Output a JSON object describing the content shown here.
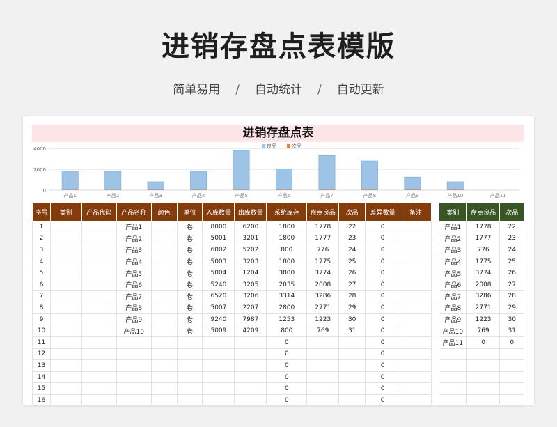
{
  "page": {
    "title": "进销存盘点表模版",
    "tags": [
      "简单易用",
      "自动统计",
      "自动更新"
    ],
    "separator": "/"
  },
  "sheet": {
    "title": "进销存盘点表",
    "columns": [
      "序号",
      "类别",
      "产品代码",
      "产品名称",
      "颜色",
      "单位",
      "入库数量",
      "出库数量",
      "系统库存",
      "盘点良品",
      "次品",
      "差异数量",
      "备注"
    ],
    "rows": [
      [
        "1",
        "",
        "",
        "产品1",
        "",
        "卷",
        "8000",
        "6200",
        "1800",
        "1778",
        "22",
        "0",
        ""
      ],
      [
        "2",
        "",
        "",
        "产品2",
        "",
        "卷",
        "5001",
        "3201",
        "1800",
        "1777",
        "23",
        "0",
        ""
      ],
      [
        "3",
        "",
        "",
        "产品3",
        "",
        "卷",
        "6002",
        "5202",
        "800",
        "776",
        "24",
        "0",
        ""
      ],
      [
        "4",
        "",
        "",
        "产品4",
        "",
        "卷",
        "5003",
        "3203",
        "1800",
        "1775",
        "25",
        "0",
        ""
      ],
      [
        "5",
        "",
        "",
        "产品5",
        "",
        "卷",
        "5004",
        "1204",
        "3800",
        "3774",
        "26",
        "0",
        ""
      ],
      [
        "6",
        "",
        "",
        "产品6",
        "",
        "卷",
        "5240",
        "3205",
        "2035",
        "2008",
        "27",
        "0",
        ""
      ],
      [
        "7",
        "",
        "",
        "产品7",
        "",
        "卷",
        "6520",
        "3206",
        "3314",
        "3286",
        "28",
        "0",
        ""
      ],
      [
        "8",
        "",
        "",
        "产品8",
        "",
        "卷",
        "5007",
        "2207",
        "2800",
        "2771",
        "29",
        "0",
        ""
      ],
      [
        "9",
        "",
        "",
        "产品9",
        "",
        "卷",
        "9240",
        "7987",
        "1253",
        "1223",
        "30",
        "0",
        ""
      ],
      [
        "10",
        "",
        "",
        "产品10",
        "",
        "卷",
        "5009",
        "4209",
        "800",
        "769",
        "31",
        "0",
        ""
      ],
      [
        "11",
        "",
        "",
        "",
        "",
        "",
        "",
        "",
        "0",
        "",
        "",
        "0",
        ""
      ],
      [
        "12",
        "",
        "",
        "",
        "",
        "",
        "",
        "",
        "0",
        "",
        "",
        "0",
        ""
      ],
      [
        "13",
        "",
        "",
        "",
        "",
        "",
        "",
        "",
        "0",
        "",
        "",
        "0",
        ""
      ],
      [
        "14",
        "",
        "",
        "",
        "",
        "",
        "",
        "",
        "0",
        "",
        "",
        "0",
        ""
      ],
      [
        "15",
        "",
        "",
        "",
        "",
        "",
        "",
        "",
        "0",
        "",
        "",
        "0",
        ""
      ],
      [
        "16",
        "",
        "",
        "",
        "",
        "",
        "",
        "",
        "0",
        "",
        "",
        "0",
        ""
      ]
    ]
  },
  "summary": {
    "columns": [
      "类别",
      "盘点良品",
      "次品"
    ],
    "rows": [
      [
        "产品1",
        "1778",
        "22"
      ],
      [
        "产品2",
        "1777",
        "23"
      ],
      [
        "产品3",
        "776",
        "24"
      ],
      [
        "产品4",
        "1775",
        "25"
      ],
      [
        "产品5",
        "3774",
        "26"
      ],
      [
        "产品6",
        "2008",
        "27"
      ],
      [
        "产品7",
        "3286",
        "28"
      ],
      [
        "产品8",
        "2771",
        "29"
      ],
      [
        "产品9",
        "1223",
        "30"
      ],
      [
        "产品10",
        "769",
        "31"
      ],
      [
        "产品11",
        "0",
        "0"
      ],
      [
        "",
        "",
        ""
      ],
      [
        "",
        "",
        ""
      ],
      [
        "",
        "",
        ""
      ],
      [
        "",
        "",
        ""
      ],
      [
        "",
        "",
        ""
      ]
    ]
  },
  "chart_data": {
    "type": "bar",
    "categories": [
      "产品1",
      "产品2",
      "产品3",
      "产品4",
      "产品5",
      "产品6",
      "产品7",
      "产品8",
      "产品9",
      "产品10",
      "产品11"
    ],
    "series": [
      {
        "name": "良品",
        "values": [
          1778,
          1777,
          776,
          1775,
          3774,
          2008,
          3286,
          2771,
          1223,
          769,
          0
        ],
        "color": "#9dc3e6"
      },
      {
        "name": "次品",
        "values": [
          22,
          23,
          24,
          25,
          26,
          27,
          28,
          29,
          30,
          31,
          0
        ],
        "color": "#ed7d31"
      }
    ],
    "yticks": [
      "0",
      "2000",
      "4000"
    ],
    "ylim": [
      0,
      4000
    ],
    "legend_position": "top-center",
    "grid": true
  },
  "colors": {
    "main_header": "#843c0c",
    "side_header": "#375623",
    "title_band": "#fde4e6"
  }
}
